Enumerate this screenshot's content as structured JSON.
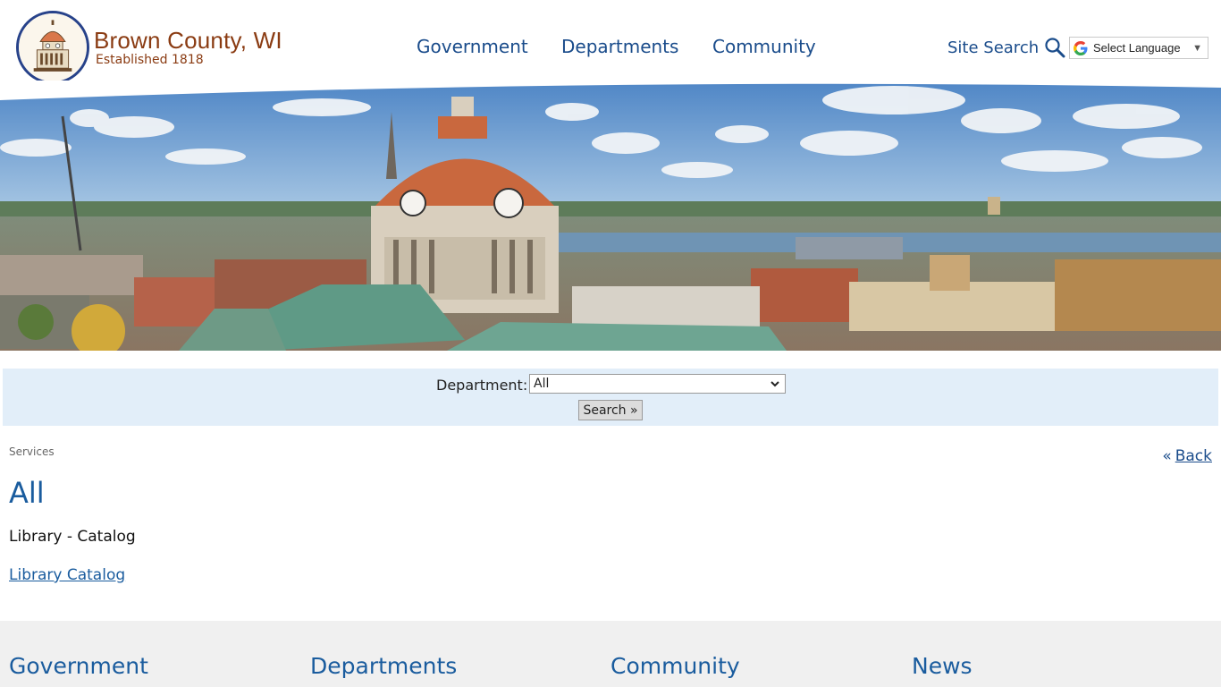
{
  "header": {
    "site_name": "Brown County, WI",
    "established": "Established 1818",
    "nav": {
      "government": "Government",
      "departments": "Departments",
      "community": "Community"
    },
    "site_search_label": "Site Search",
    "language_select": "Select Language"
  },
  "filter": {
    "department_label": "Department:",
    "department_value": "All",
    "search_button": "Search »"
  },
  "content": {
    "breadcrumb": "Services",
    "back_arrow": "«",
    "back_label": "Back",
    "page_title": "All",
    "service_name": "Library - Catalog",
    "service_link": "Library Catalog"
  },
  "footer": {
    "col1": "Government",
    "col2": "Departments",
    "col3": "Community",
    "col4": "News"
  },
  "colors": {
    "brand_brown": "#8a3b12",
    "link_blue": "#1a4c8b",
    "filter_bg": "#e2eef9",
    "footer_bg": "#f0f0f0"
  }
}
